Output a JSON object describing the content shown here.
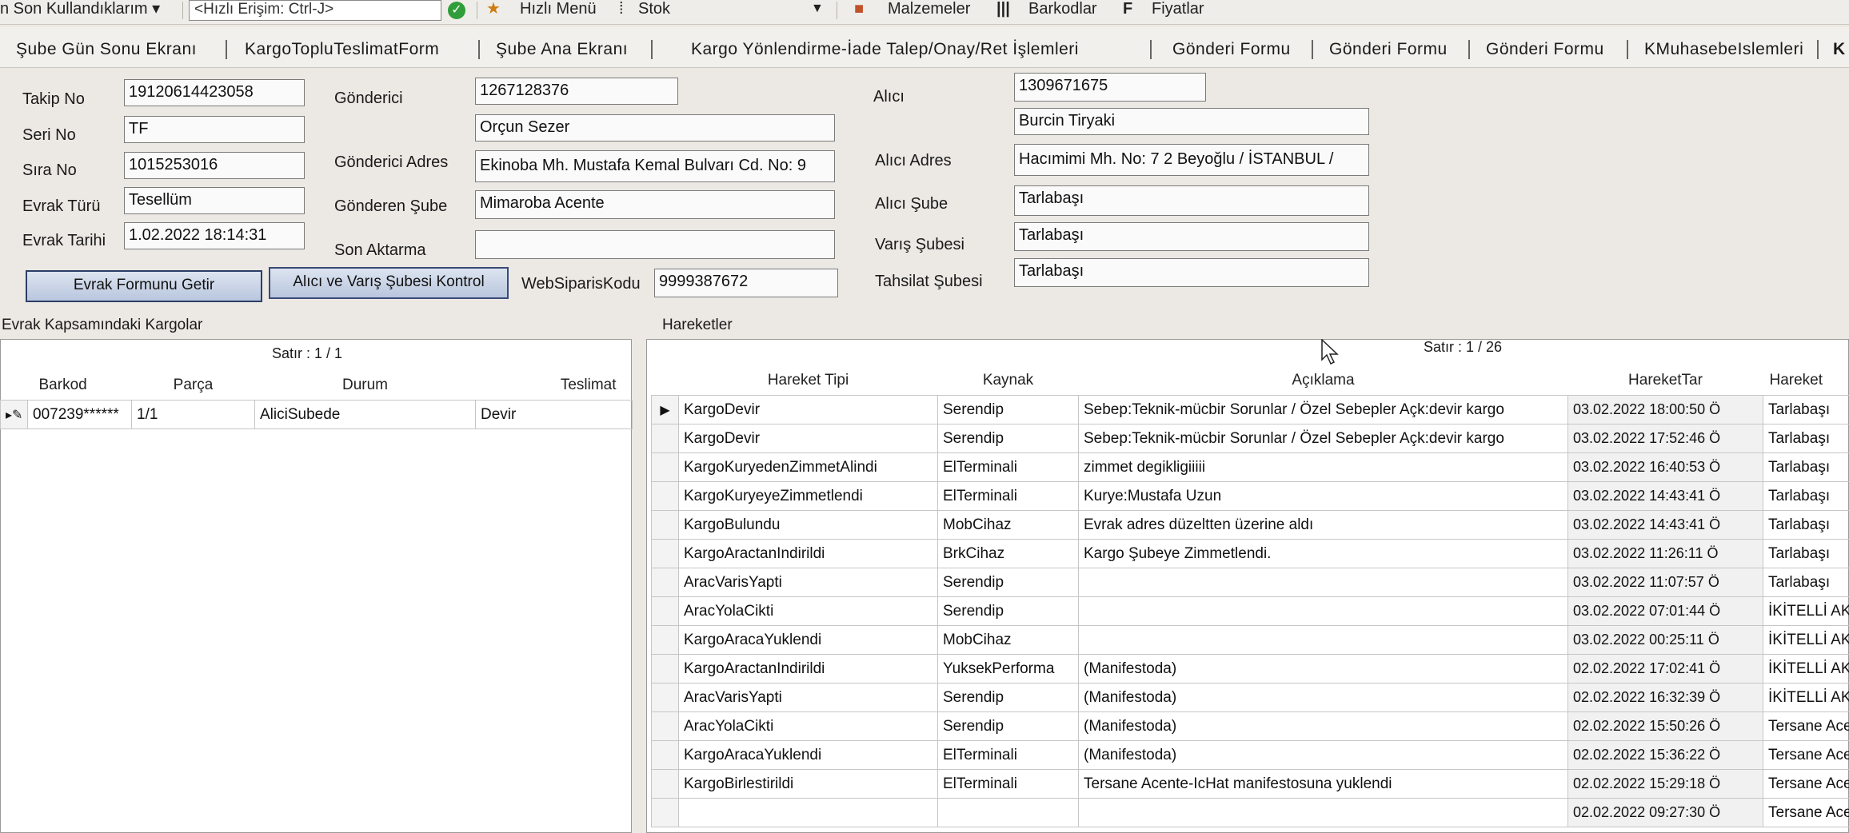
{
  "toolbar": {
    "recent": "n Son Kullandıklarım ▾",
    "quick_access_placeholder": "<Hızlı Erişim: Ctrl-J>",
    "quick_menu": "Hızlı Menü",
    "stock": "Stok",
    "materials": "Malzemeler",
    "barcodes": "Barkodlar",
    "prices": "Fiyatlar"
  },
  "tabs": [
    "Şube Gün Sonu Ekranı",
    "KargoTopluTeslimatForm",
    "Şube Ana Ekranı",
    "Kargo Yönlendirme-İade Talep/Onay/Ret İşlemleri",
    "Gönderi Formu",
    "Gönderi Formu",
    "Gönderi Formu",
    "KMuhasebeIslemleri",
    "K"
  ],
  "form": {
    "takip_no": {
      "label": "Takip No",
      "value": "19120614423058"
    },
    "seri_no": {
      "label": "Seri No",
      "value": "TF"
    },
    "sira_no": {
      "label": "Sıra No",
      "value": "1015253016"
    },
    "evrak_turu": {
      "label": "Evrak Türü",
      "value": "Tesellüm"
    },
    "evrak_tarihi": {
      "label": "Evrak Tarihi",
      "value": "1.02.2022 18:14:31"
    },
    "gonderici": {
      "label": "Gönderici",
      "value_id": "1267128376",
      "value_name": "Orçun Sezer"
    },
    "gonderici_adres": {
      "label": "Gönderici Adres",
      "value": "Ekinoba Mh. Mustafa Kemal Bulvarı Cd. No: 9"
    },
    "gonderen_sube": {
      "label": "Gönderen Şube",
      "value": "Mimaroba Acente"
    },
    "son_aktarma": {
      "label": "Son Aktarma",
      "value": ""
    },
    "web_siparis": {
      "label": "WebSiparisKodu",
      "value": "9999387672"
    },
    "alici": {
      "label": "Alıcı",
      "value_id": "1309671675",
      "value_name": "Burcin Tiryaki"
    },
    "alici_adres": {
      "label": "Alıcı Adres",
      "value": "Hacımimi Mh. No: 7 2 Beyoğlu / İSTANBUL /"
    },
    "alici_sube": {
      "label": "Alıcı Şube",
      "value": "Tarlabaşı"
    },
    "varis_subesi": {
      "label": "Varış Şubesi",
      "value": "Tarlabaşı"
    },
    "tahsilat_subesi": {
      "label": "Tahsilat Şubesi",
      "value": "Tarlabaşı"
    },
    "btn_evrak": "Evrak Formunu Getir",
    "btn_kontrol": "Alıcı ve Varış Şubesi Kontrol"
  },
  "left_panel": {
    "title": "Evrak Kapsamındaki Kargolar",
    "row_count": "Satır : 1 / 1",
    "columns": [
      "Barkod",
      "Parça",
      "Durum",
      "Teslimat"
    ],
    "rows": [
      {
        "barkod": "007239******",
        "parca": "1/1",
        "durum": "AliciSubede",
        "teslimat": "Devir"
      }
    ]
  },
  "right_panel": {
    "title": "Hareketler",
    "row_count": "Satır : 1 / 26",
    "columns": [
      "Hareket Tipi",
      "Kaynak",
      "Açıklama",
      "HareketTar",
      "Hareket"
    ],
    "rows": [
      [
        "KargoDevir",
        "Serendip",
        "Sebep:Teknik-mücbir Sorunlar / Özel Sebepler Açk:devir  kargo",
        "03.02.2022 18:00:50 Ö",
        "Tarlabaşı"
      ],
      [
        "KargoDevir",
        "Serendip",
        "Sebep:Teknik-mücbir Sorunlar / Özel Sebepler Açk:devir  kargo",
        "03.02.2022 17:52:46 Ö",
        "Tarlabaşı"
      ],
      [
        "KargoKuryedenZimmetAlindi",
        "ElTerminali",
        "zimmet degikligiiiii",
        "03.02.2022 16:40:53 Ö",
        "Tarlabaşı"
      ],
      [
        "KargoKuryeyeZimmetlendi",
        "ElTerminali",
        "Kurye:Mustafa Uzun",
        "03.02.2022 14:43:41 Ö",
        "Tarlabaşı"
      ],
      [
        "KargoBulundu",
        "MobCihaz",
        "Evrak adres düzeltten üzerine aldı",
        "03.02.2022 14:43:41 Ö",
        "Tarlabaşı"
      ],
      [
        "KargoAractanIndirildi",
        "BrkCihaz",
        "Kargo Şubeye Zimmetlendi.",
        "03.02.2022 11:26:11 Ö",
        "Tarlabaşı"
      ],
      [
        "AracVarisYapti",
        "Serendip",
        "",
        "03.02.2022 11:07:57 Ö",
        "Tarlabaşı"
      ],
      [
        "AracYolaCikti",
        "Serendip",
        "",
        "03.02.2022 07:01:44 Ö",
        "İKİTELLİ AK"
      ],
      [
        "KargoAracaYuklendi",
        "MobCihaz",
        "",
        "03.02.2022 00:25:11 Ö",
        "İKİTELLİ AK"
      ],
      [
        "KargoAractanIndirildi",
        "YuksekPerforma",
        "(Manifestoda)",
        "02.02.2022 17:02:41 Ö",
        "İKİTELLİ AK"
      ],
      [
        "AracVarisYapti",
        "Serendip",
        "(Manifestoda)",
        "02.02.2022 16:32:39 Ö",
        "İKİTELLİ AK"
      ],
      [
        "AracYolaCikti",
        "Serendip",
        "(Manifestoda)",
        "02.02.2022 15:50:26 Ö",
        "Tersane Ace"
      ],
      [
        "KargoAracaYuklendi",
        "ElTerminali",
        "(Manifestoda)",
        "02.02.2022 15:36:22 Ö",
        "Tersane Ace"
      ],
      [
        "KargoBirlestirildi",
        "ElTerminali",
        "Tersane Acente-IcHat manifestosuna yuklendi",
        "02.02.2022 15:29:18 Ö",
        "Tersane Ace"
      ],
      [
        "",
        "",
        "",
        "02.02.2022 09:27:30 Ö",
        "Tersane Ace"
      ]
    ]
  }
}
